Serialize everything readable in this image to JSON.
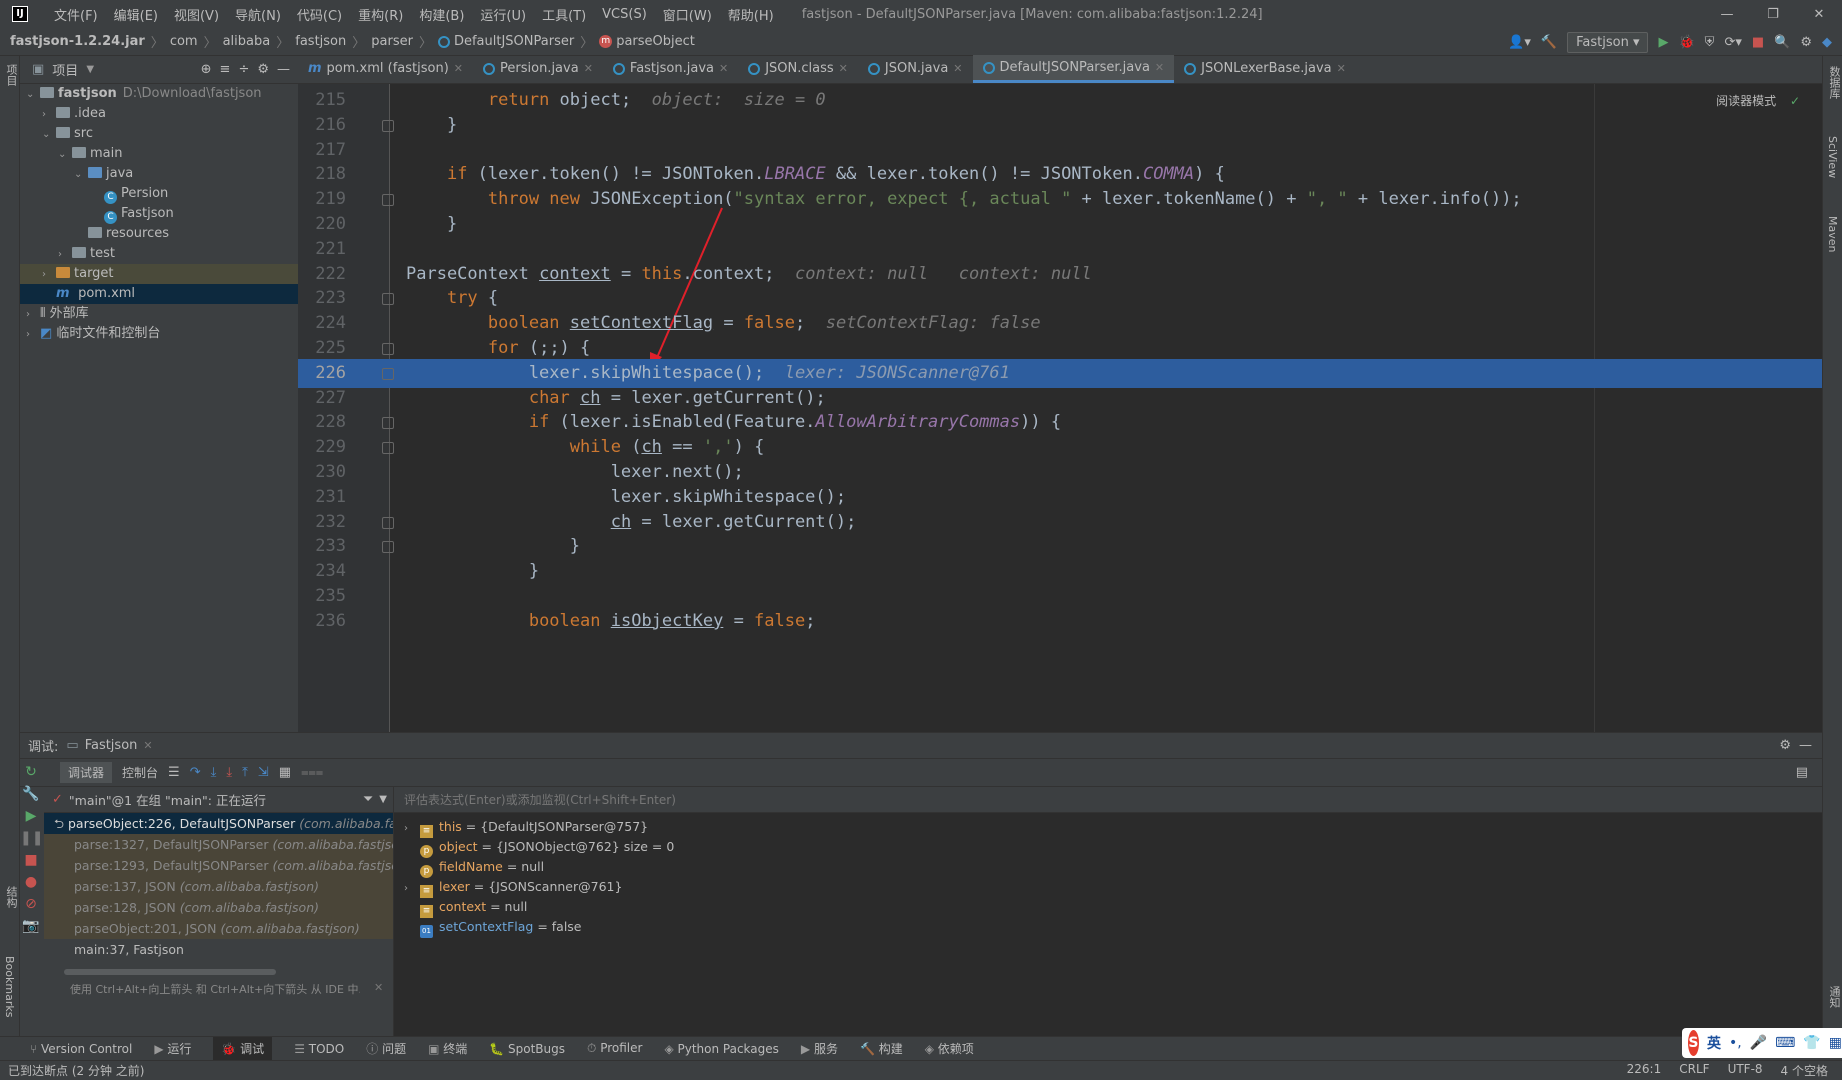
{
  "app": {
    "logo": "IJ",
    "title": "fastjson - DefaultJSONParser.java [Maven: com.alibaba:fastjson:1.2.24]",
    "menu": [
      "文件(F)",
      "编辑(E)",
      "视图(V)",
      "导航(N)",
      "代码(C)",
      "重构(R)",
      "构建(B)",
      "运行(U)",
      "工具(T)",
      "VCS(S)",
      "窗口(W)",
      "帮助(H)"
    ]
  },
  "breadcrumb": [
    "fastjson-1.2.24.jar",
    "com",
    "alibaba",
    "fastjson",
    "parser",
    "DefaultJSONParser",
    "parseObject"
  ],
  "toolbar": {
    "run_config": "Fastjson"
  },
  "project": {
    "header": "项目",
    "rows": [
      {
        "label": "fastjson",
        "extra": "D:\\Download\\fastjson",
        "indent": 0,
        "arrow": "v",
        "icon": "folder"
      },
      {
        "label": ".idea",
        "indent": 1,
        "arrow": ">",
        "icon": "folder"
      },
      {
        "label": "src",
        "indent": 1,
        "arrow": "v",
        "icon": "folder"
      },
      {
        "label": "main",
        "indent": 2,
        "arrow": "v",
        "icon": "folder"
      },
      {
        "label": "java",
        "indent": 3,
        "arrow": "v",
        "icon": "folder-blue"
      },
      {
        "label": "Persion",
        "indent": 4,
        "arrow": "",
        "icon": "class"
      },
      {
        "label": "Fastjson",
        "indent": 4,
        "arrow": "",
        "icon": "class"
      },
      {
        "label": "resources",
        "indent": 3,
        "arrow": "",
        "icon": "folder"
      },
      {
        "label": "test",
        "indent": 2,
        "arrow": ">",
        "icon": "folder"
      },
      {
        "label": "target",
        "indent": 1,
        "arrow": ">",
        "icon": "folder-orange",
        "state": "sel2"
      },
      {
        "label": "pom.xml",
        "indent": 1,
        "arrow": "",
        "icon": "maven",
        "state": "sel"
      },
      {
        "label": "外部库",
        "indent": 0,
        "arrow": ">",
        "icon": "lib"
      },
      {
        "label": "临时文件和控制台",
        "indent": 0,
        "arrow": ">",
        "icon": "scratch"
      }
    ]
  },
  "tabs": [
    {
      "label": "pom.xml (fastjson)",
      "icon": "m"
    },
    {
      "label": "Persion.java",
      "icon": "c"
    },
    {
      "label": "Fastjson.java",
      "icon": "c"
    },
    {
      "label": "JSON.class",
      "icon": "c"
    },
    {
      "label": "JSON.java",
      "icon": "c"
    },
    {
      "label": "DefaultJSONParser.java",
      "icon": "c",
      "active": true
    },
    {
      "label": "JSONLexerBase.java",
      "icon": "c"
    }
  ],
  "editor": {
    "reader_mode": "阅读器模式",
    "first_line": 215,
    "current_line": 226
  },
  "debug": {
    "label": "调试:",
    "session": "Fastjson",
    "tab_debugger": "调试器",
    "tab_console": "控制台",
    "thread": "\"main\"@1 在组 \"main\": 正在运行",
    "frames": [
      {
        "method": "parseObject:226, DefaultJSONParser",
        "pkg": "(com.alibaba.fastjson.parser)",
        "kind": "cur"
      },
      {
        "method": "parse:1327, DefaultJSONParser",
        "pkg": "(com.alibaba.fastjson.parser)",
        "kind": "lib"
      },
      {
        "method": "parse:1293, DefaultJSONParser",
        "pkg": "(com.alibaba.fastjson.parser)",
        "kind": "lib"
      },
      {
        "method": "parse:137, JSON",
        "pkg": "(com.alibaba.fastjson)",
        "kind": "lib"
      },
      {
        "method": "parse:128, JSON",
        "pkg": "(com.alibaba.fastjson)",
        "kind": "lib"
      },
      {
        "method": "parseObject:201, JSON",
        "pkg": "(com.alibaba.fastjson)",
        "kind": "lib"
      },
      {
        "method": "main:37, Fastjson",
        "pkg": "",
        "kind": "plain"
      }
    ],
    "frames_hint": "使用 Ctrl+Alt+向上箭头 和 Ctrl+Alt+向下箭头 从 IDE 中...",
    "eval_placeholder": "评估表达式(Enter)或添加监视(Ctrl+Shift+Enter)",
    "vars": [
      {
        "name": "this",
        "value": " = {DefaultJSONParser@757}",
        "icon": "sq",
        "expand": true
      },
      {
        "name": "object",
        "value": " = {JSONObject@762}  size = 0",
        "icon": "p",
        "expand": false
      },
      {
        "name": "fieldName",
        "value": " = null",
        "icon": "p",
        "expand": false
      },
      {
        "name": "lexer",
        "value": " = {JSONScanner@761}",
        "icon": "sq",
        "expand": true
      },
      {
        "name": "context",
        "value": " = null",
        "icon": "sq",
        "expand": false
      },
      {
        "name": "setContextFlag",
        "value": " = false",
        "icon": "bl",
        "expand": false
      }
    ]
  },
  "bottom_tools": [
    "Version Control",
    "运行",
    "调试",
    "TODO",
    "问题",
    "终端",
    "SpotBugs",
    "Profiler",
    "Python Packages",
    "服务",
    "构建",
    "依赖项"
  ],
  "status": {
    "message": "已到达断点 (2 分钟 之前)",
    "position": "226:1",
    "line_sep": "CRLF",
    "encoding": "UTF-8",
    "indent": "4 个空格"
  },
  "side": {
    "left_top": "项目",
    "left_mid": "结构",
    "left_bot": "Bookmarks",
    "right_1": "数据库",
    "right_2": "SciView",
    "right_3": "Maven",
    "right_4": "通知"
  },
  "ime": {
    "logo": "S",
    "lang": "英"
  }
}
